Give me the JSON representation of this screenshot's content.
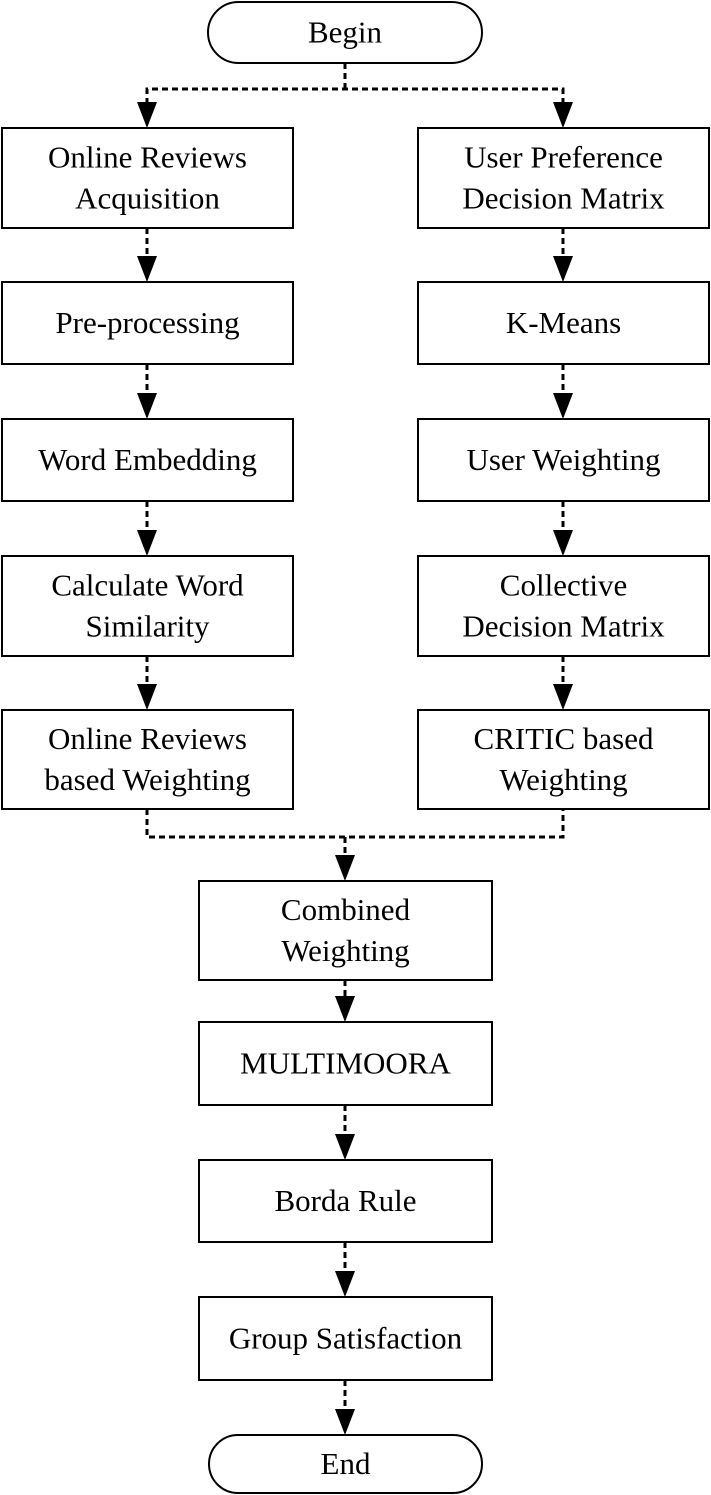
{
  "diagram": {
    "start": {
      "label": "Begin"
    },
    "end": {
      "label": "End"
    },
    "left_branch": [
      {
        "lines": [
          "Online Reviews",
          "Acquisition"
        ]
      },
      {
        "lines": [
          "Pre-processing"
        ]
      },
      {
        "lines": [
          "Word Embedding"
        ]
      },
      {
        "lines": [
          "Calculate Word",
          "Similarity"
        ]
      },
      {
        "lines": [
          "Online Reviews",
          "based Weighting"
        ]
      }
    ],
    "right_branch": [
      {
        "lines": [
          "User Preference",
          "Decision Matrix"
        ]
      },
      {
        "lines": [
          "K-Means"
        ]
      },
      {
        "lines": [
          "User Weighting"
        ]
      },
      {
        "lines": [
          "Collective",
          "Decision Matrix"
        ]
      },
      {
        "lines": [
          "CRITIC based",
          "Weighting"
        ]
      }
    ],
    "merged": [
      {
        "lines": [
          "Combined",
          "Weighting"
        ]
      },
      {
        "lines": [
          "MULTIMOORA"
        ]
      },
      {
        "lines": [
          "Borda Rule"
        ]
      },
      {
        "lines": [
          "Group Satisfaction"
        ]
      }
    ],
    "connector_style": "dashed arrows"
  }
}
